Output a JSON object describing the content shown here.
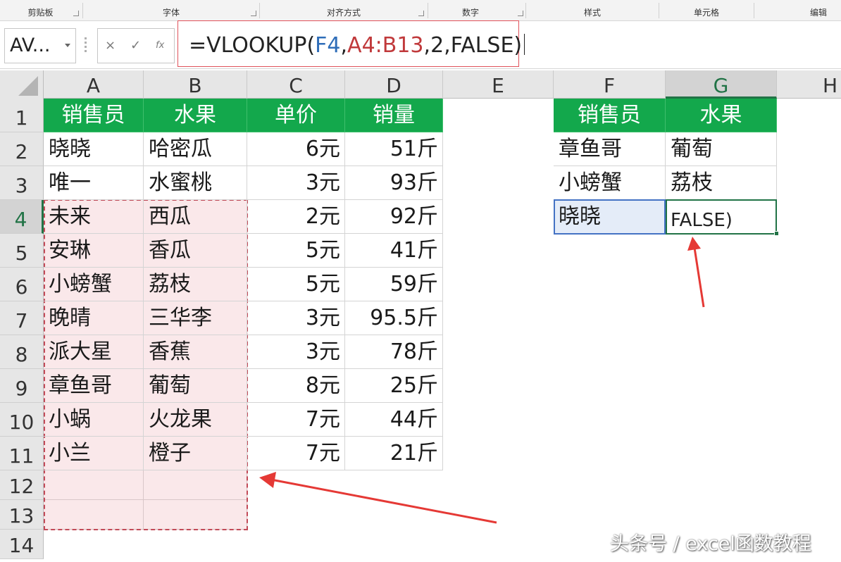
{
  "ribbon": {
    "groups": [
      "剪贴板",
      "字体",
      "对齐方式",
      "数字",
      "样式",
      "单元格",
      "编辑"
    ]
  },
  "formula_bar": {
    "name_box": "AV...",
    "cancel_icon": "×",
    "enter_icon": "✓",
    "fx_label": "fx",
    "formula": {
      "prefix": "=VLOOKUP(",
      "arg1": "F4",
      "comma1": ",",
      "arg2": "A4:B13",
      "rest": ",2,FALSE)"
    }
  },
  "columns": [
    "A",
    "B",
    "C",
    "D",
    "E",
    "F",
    "G",
    "H"
  ],
  "rows": [
    "1",
    "2",
    "3",
    "4",
    "5",
    "6",
    "7",
    "8",
    "9",
    "10",
    "11",
    "12",
    "13",
    "14"
  ],
  "table_main": {
    "headers": [
      "销售员",
      "水果",
      "单价",
      "销量"
    ],
    "rows": [
      [
        "晓晓",
        "哈密瓜",
        "6元",
        "51斤"
      ],
      [
        "唯一",
        "水蜜桃",
        "3元",
        "93斤"
      ],
      [
        "未来",
        "西瓜",
        "2元",
        "92斤"
      ],
      [
        "安琳",
        "香瓜",
        "5元",
        "41斤"
      ],
      [
        "小螃蟹",
        "荔枝",
        "5元",
        "59斤"
      ],
      [
        "晚晴",
        "三华李",
        "3元",
        "95.5斤"
      ],
      [
        "派大星",
        "香蕉",
        "3元",
        "78斤"
      ],
      [
        "章鱼哥",
        "葡萄",
        "8元",
        "25斤"
      ],
      [
        "小蜗",
        "火龙果",
        "7元",
        "44斤"
      ],
      [
        "小兰",
        "橙子",
        "7元",
        "21斤"
      ]
    ]
  },
  "table_lookup": {
    "headers": [
      "销售员",
      "水果"
    ],
    "rows": [
      [
        "章鱼哥",
        "葡萄"
      ],
      [
        "小螃蟹",
        "荔枝"
      ],
      [
        "晓晓",
        "FALSE)"
      ]
    ]
  },
  "colors": {
    "header_green": "#13a84c",
    "excel_green": "#217346",
    "range_red": "#c24a58",
    "ref_blue": "#4472c4"
  },
  "watermark": "头条号 / excel函数教程"
}
